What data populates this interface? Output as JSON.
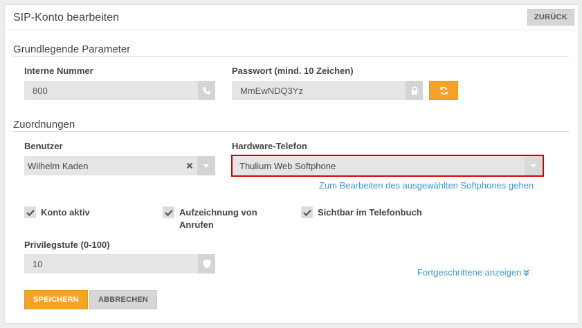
{
  "header": {
    "title": "SIP-Konto bearbeiten",
    "back_label": "ZURÜCK"
  },
  "sections": {
    "basic": {
      "title": "Grundlegende Parameter",
      "internal_number": {
        "label": "Interne Nummer",
        "value": "800",
        "icon": "phone-icon"
      },
      "password": {
        "label": "Passwort (mind. 10 Zeichen)",
        "value": "MmEwNDQ3Yz",
        "icon": "lock-icon",
        "refresh_icon": "refresh-icon"
      }
    },
    "assignments": {
      "title": "Zuordnungen",
      "user": {
        "label": "Benutzer",
        "value": "Wilhelm Kaden"
      },
      "hardware_phone": {
        "label": "Hardware-Telefon",
        "value": "Thulium Web Softphone"
      },
      "edit_softphone_link": "Zum Bearbeiten des ausgewählten Softphones gehen"
    }
  },
  "checkboxes": [
    {
      "label_line1": "Konto aktiv",
      "label_line2": "",
      "checked": true
    },
    {
      "label_line1": "Aufzeichnung von",
      "label_line2": "Anrufen",
      "checked": true
    },
    {
      "label_line1": "Sichtbar im Telefonbuch",
      "label_line2": "",
      "checked": true
    }
  ],
  "privilege": {
    "label": "Privilegstufe (0-100)",
    "value": "10",
    "icon": "shield-icon"
  },
  "advanced_link": "Fortgeschrittene anzeigen",
  "actions": {
    "save_label": "SPEICHERN",
    "cancel_label": "ABBRECHEN"
  },
  "colors": {
    "accent": "#f5a327",
    "link": "#3a97d4",
    "highlight": "#d40000"
  }
}
